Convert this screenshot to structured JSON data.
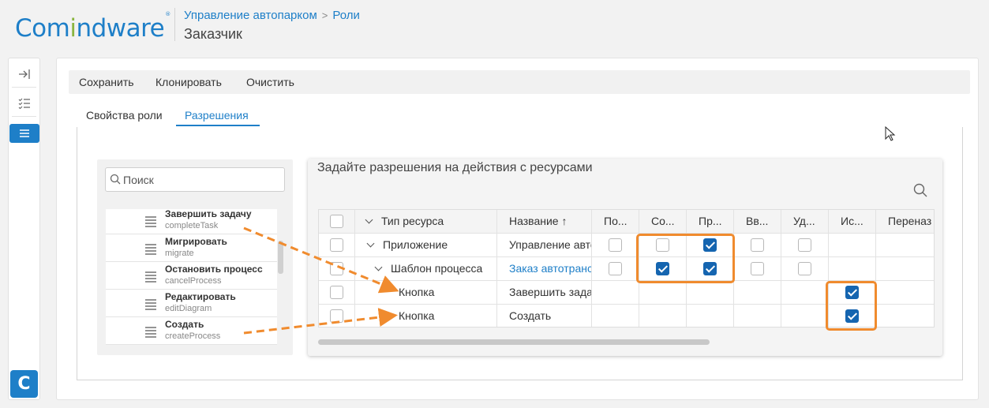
{
  "header": {
    "logo_part1": "Com",
    "logo_part2": "i",
    "logo_part3": "ndware",
    "logo_mark": "®",
    "breadcrumb": [
      "Управление автопарком",
      "Роли"
    ],
    "breadcrumb_separator": ">",
    "title": "Заказчик"
  },
  "rail": {
    "icons": [
      "collapse-icon",
      "task-list-icon",
      "menu-icon"
    ],
    "logo_letter": "C"
  },
  "toolbar": {
    "save_label": "Сохранить",
    "clone_label": "Клонировать",
    "clear_label": "Очистить"
  },
  "tabs": [
    {
      "label": "Свойства роли",
      "active": false
    },
    {
      "label": "Разрешения",
      "active": true
    }
  ],
  "left_panel": {
    "search_placeholder": "Поиск",
    "items": [
      {
        "title": "Завершить задачу",
        "code": "completeTask"
      },
      {
        "title": "Мигрировать",
        "code": "migrate"
      },
      {
        "title": "Остановить процесс",
        "code": "cancelProcess"
      },
      {
        "title": "Редактировать",
        "code": "editDiagram"
      },
      {
        "title": "Создать",
        "code": "createProcess"
      }
    ]
  },
  "permissions": {
    "title": "Задайте разрешения на действия с ресурсами",
    "columns": [
      "Тип ресурса",
      "Название ↑",
      "По...",
      "Со...",
      "Пр...",
      "Вв...",
      "Уд...",
      "Ис...",
      "Переназ"
    ],
    "rows": [
      {
        "type": "Приложение",
        "name": "Управление автопарком",
        "name_is_link": false,
        "po": false,
        "so": false,
        "pr": true,
        "vv": false,
        "ud": false,
        "is": null
      },
      {
        "type": "Шаблон процесса",
        "name": "Заказ автотранспорта",
        "name_is_link": true,
        "po": false,
        "so": true,
        "pr": true,
        "vv": false,
        "ud": false,
        "is": null
      },
      {
        "type": "Кнопка",
        "name": "Завершить задачу",
        "name_is_link": false,
        "po": null,
        "so": null,
        "pr": null,
        "vv": null,
        "ud": null,
        "is": true
      },
      {
        "type": "Кнопка",
        "name": "Создать",
        "name_is_link": false,
        "po": null,
        "so": null,
        "pr": null,
        "vv": null,
        "ud": null,
        "is": true
      }
    ]
  },
  "colors": {
    "accent": "#1e7fc8",
    "logo_green": "#8ab53f",
    "checkbox_checked": "#1565b0",
    "annotation_orange": "#f08b2e"
  }
}
